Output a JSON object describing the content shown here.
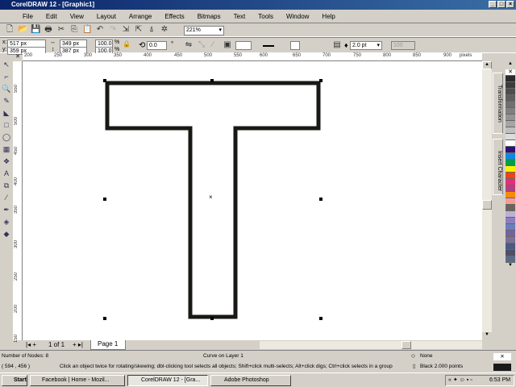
{
  "window": {
    "title": "CorelDRAW 12 - [Graphic1]"
  },
  "menu": [
    "File",
    "Edit",
    "View",
    "Layout",
    "Arrange",
    "Effects",
    "Bitmaps",
    "Text",
    "Tools",
    "Window",
    "Help"
  ],
  "toolbar": {
    "zoom": "221%"
  },
  "property_bar": {
    "x": "517 px",
    "y": "359 px",
    "width": "349 px",
    "height": "387 px",
    "scale_x": "100.0",
    "scale_y": "100.0",
    "pct": "%",
    "rotation": "0.0",
    "deg": "°",
    "outline_width": "2.0 pt",
    "transparency": "100"
  },
  "ruler": {
    "units": "pixels",
    "h_labels": [
      "200",
      "250",
      "300",
      "350",
      "400",
      "450",
      "500",
      "550",
      "600",
      "650",
      "700",
      "750",
      "800",
      "850",
      "900"
    ],
    "v_labels": [
      "550",
      "500",
      "450",
      "400",
      "350",
      "300",
      "250",
      "200",
      "150"
    ]
  },
  "dockers": [
    "Transformation",
    "Insert Character"
  ],
  "palette": [
    "#2b2b2b",
    "#3c3c3c",
    "#4d4d4d",
    "#5e5e5e",
    "#707070",
    "#808080",
    "#939393",
    "#a5a5a5",
    "#bfbfbf",
    "#dcdcdc",
    "#ffffff",
    "#2e0f7e",
    "#0a8be0",
    "#079a4a",
    "#f7f205",
    "#ee4312",
    "#ea2b7c",
    "#b0417e",
    "#f78a0a",
    "#f69c98",
    "#6e6359",
    "#bbb0d8",
    "#8d7fbe",
    "#6a7fbf",
    "#76619f",
    "#7d7094",
    "#4b5a83",
    "#4f4f66",
    "#5a6b8a"
  ],
  "pages": {
    "nav": "1 of 1",
    "tab": "Page 1"
  },
  "status": {
    "nodes": "Number of Nodes: 8",
    "layer": "Curve on Layer 1",
    "coords": "( 594 , 456 )",
    "hint": "Click an object twice for rotating/skewing; dbl-clicking tool selects all objects; Shift+click multi-selects; Alt+click digs; Ctrl+click selects in a group",
    "fill": "None",
    "outline": "Black  2.000 points"
  },
  "taskbar": {
    "start": "Start",
    "tasks": [
      "Facebook | Home - Mozil...",
      "CorelDRAW 12 - [Gra...",
      "Adobe Photoshop"
    ],
    "clock": "6:53 PM"
  }
}
